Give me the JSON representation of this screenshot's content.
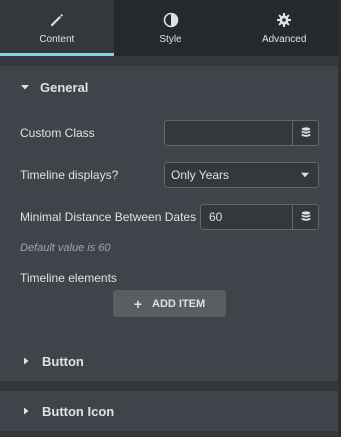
{
  "tabs": [
    {
      "label": "Content",
      "icon": "pencil-icon",
      "active": true
    },
    {
      "label": "Style",
      "icon": "half-circle-icon",
      "active": false
    },
    {
      "label": "Advanced",
      "icon": "gear-icon",
      "active": false
    }
  ],
  "general": {
    "title": "General",
    "custom_class": {
      "label": "Custom Class",
      "value": ""
    },
    "timeline_displays": {
      "label": "Timeline displays?",
      "value": "Only Years"
    },
    "min_distance": {
      "label": "Minimal Distance Between Dates",
      "value": "60",
      "help": "Default value is 60"
    },
    "timeline_elements": {
      "label": "Timeline elements",
      "add_item_label": "ADD ITEM"
    }
  },
  "sections": [
    {
      "title": "Button"
    },
    {
      "title": "Button Icon"
    }
  ],
  "colors": {
    "accent": "#71d7f7",
    "panel_bg": "#404349",
    "tab_bg": "#26292c"
  }
}
